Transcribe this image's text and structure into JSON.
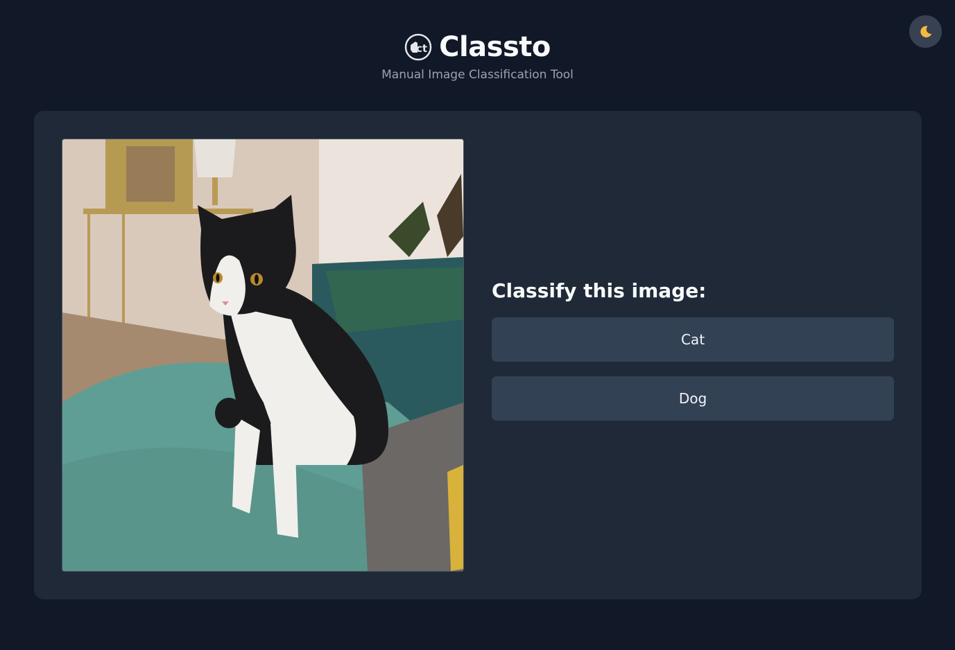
{
  "app": {
    "title": "Classto",
    "subtitle": "Manual Image Classification Tool",
    "logo_icon": "classto-logo-icon",
    "theme_toggle_icon": "moon-icon"
  },
  "image": {
    "alt": "Black and white cat sitting on a teal blanket"
  },
  "classify": {
    "heading": "Classify this image:",
    "labels": [
      "Cat",
      "Dog"
    ]
  },
  "colors": {
    "background": "#111827",
    "card": "#1f2937",
    "button": "#334155",
    "moon": "#f5b942"
  }
}
